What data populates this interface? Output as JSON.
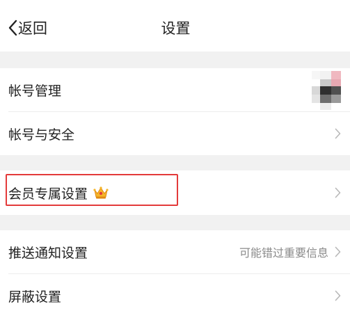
{
  "nav": {
    "back_label": "返回",
    "title": "设置"
  },
  "sections": [
    {
      "items": [
        {
          "label": "帐号管理",
          "accessory": "avatar"
        },
        {
          "label": "帐号与安全",
          "accessory": "chevron"
        }
      ]
    },
    {
      "items": [
        {
          "label": "会员专属设置",
          "accessory": "chevron",
          "badge_icon": "crown-icon",
          "highlighted": true,
          "highlight_color": "#e33a3a"
        }
      ]
    },
    {
      "items": [
        {
          "label": "推送通知设置",
          "hint": "可能错过重要信息",
          "accessory": "chevron"
        },
        {
          "label": "屏蔽设置",
          "accessory": "chevron"
        }
      ]
    }
  ],
  "colors": {
    "background": "#ffffff",
    "section_gap": "#f1f1f1",
    "text": "#222222",
    "hint_text": "#8a8a8a",
    "highlight_border": "#e33a3a",
    "chevron": "#b8b8b8"
  }
}
